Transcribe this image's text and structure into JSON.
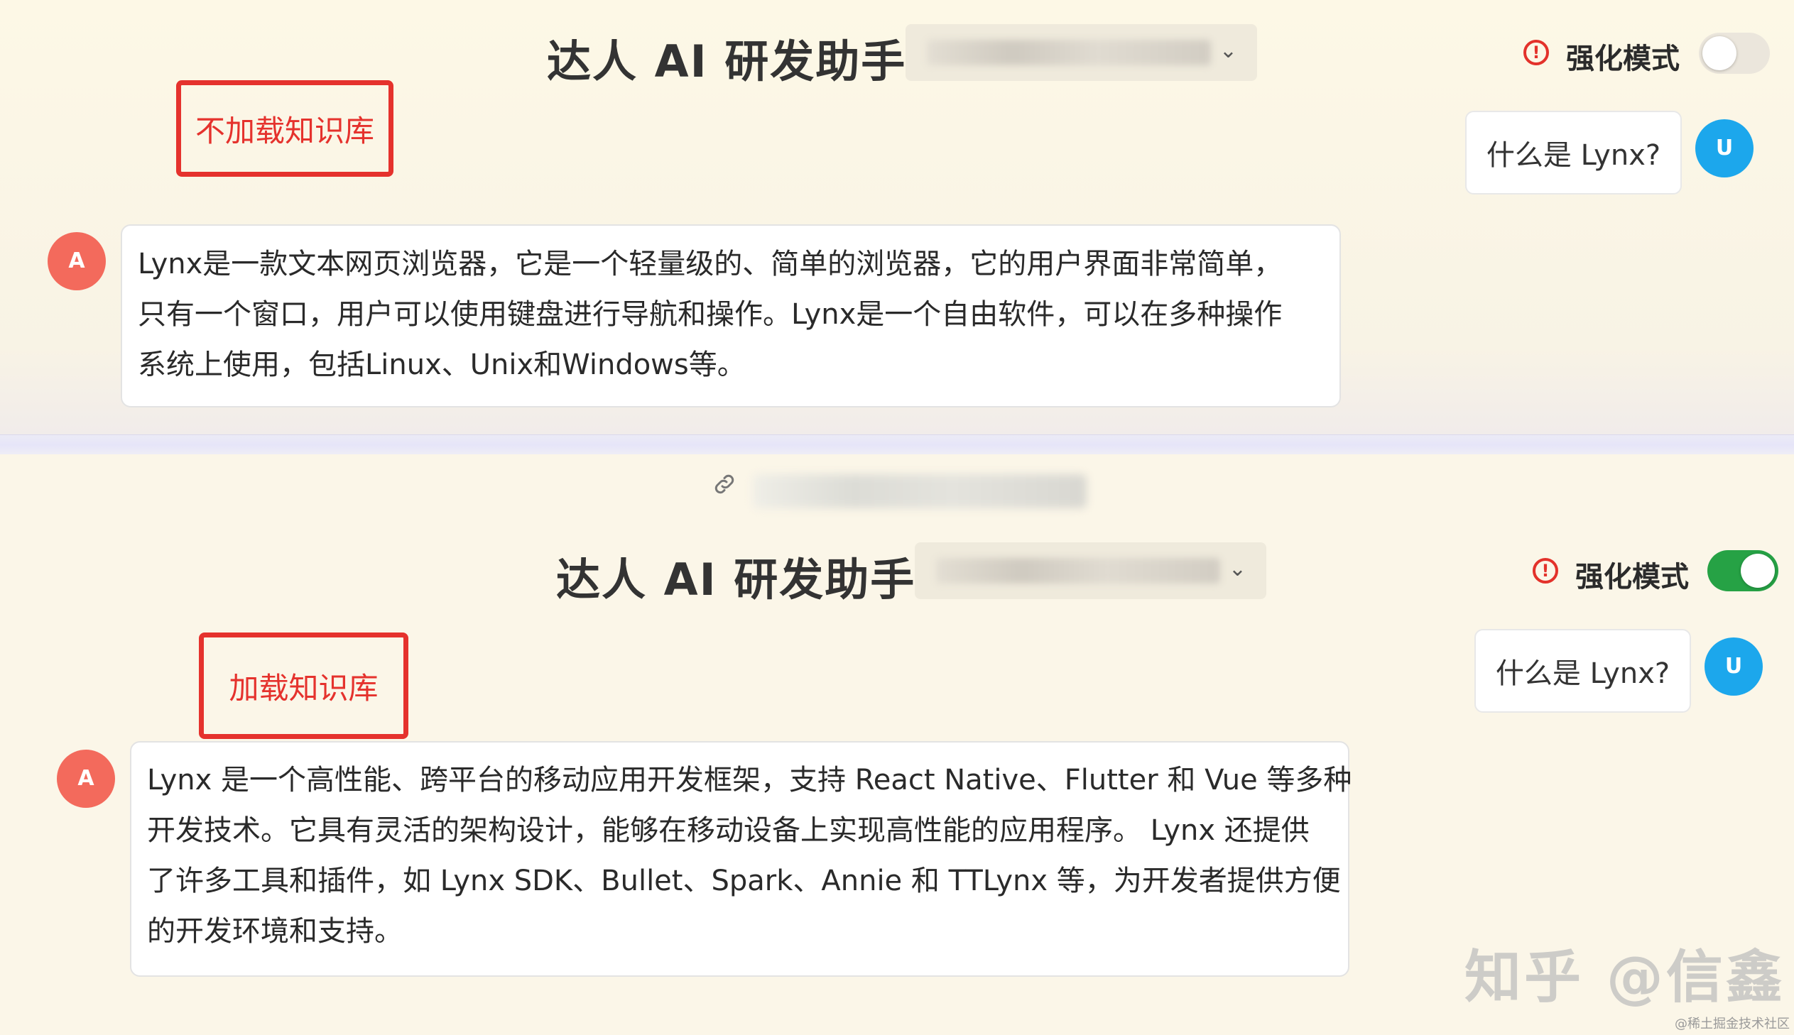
{
  "colors": {
    "annotation": "#e5322d",
    "toggle_on": "#26a245",
    "user_avatar": "#1ca7ec",
    "assistant_avatar": "#f36a5c",
    "warning": "#e3322b"
  },
  "panels": [
    {
      "title": "达人 AI 研发助手",
      "mode_label": "强化模式",
      "mode_enabled": false,
      "annotation": "不加载知识库",
      "user_avatar": "U",
      "question": "什么是 Lynx?",
      "assistant_avatar": "A",
      "answer_lines": [
        "Lynx是一款文本网页浏览器，它是一个轻量级的、简单的浏览器，它的用户界面非常简单，",
        "只有一个窗口，用户可以使用键盘进行导航和操作。Lynx是一个自由软件，可以在多种操作",
        "系统上使用，包括Linux、Unix和Windows等。"
      ]
    },
    {
      "title": "达人 AI 研发助手",
      "mode_label": "强化模式",
      "mode_enabled": true,
      "annotation": "加载知识库",
      "user_avatar": "U",
      "question": "什么是 Lynx?",
      "assistant_avatar": "A",
      "answer_lines": [
        "Lynx 是一个高性能、跨平台的移动应用开发框架，支持 React Native、Flutter 和 Vue 等多种",
        "开发技术。它具有灵活的架构设计，能够在移动设备上实现高性能的应用程序。 Lynx 还提供",
        "了许多工具和插件，如 Lynx SDK、Bullet、Spark、Annie 和 TTLynx 等，为开发者提供方便",
        "的开发环境和支持。"
      ]
    }
  ],
  "icons": {
    "warning": "warning-icon",
    "chevron": "chevron-down-icon",
    "link": "link-icon"
  },
  "watermark": "知乎 @信鑫",
  "footer_mark": "@稀土掘金技术社区"
}
